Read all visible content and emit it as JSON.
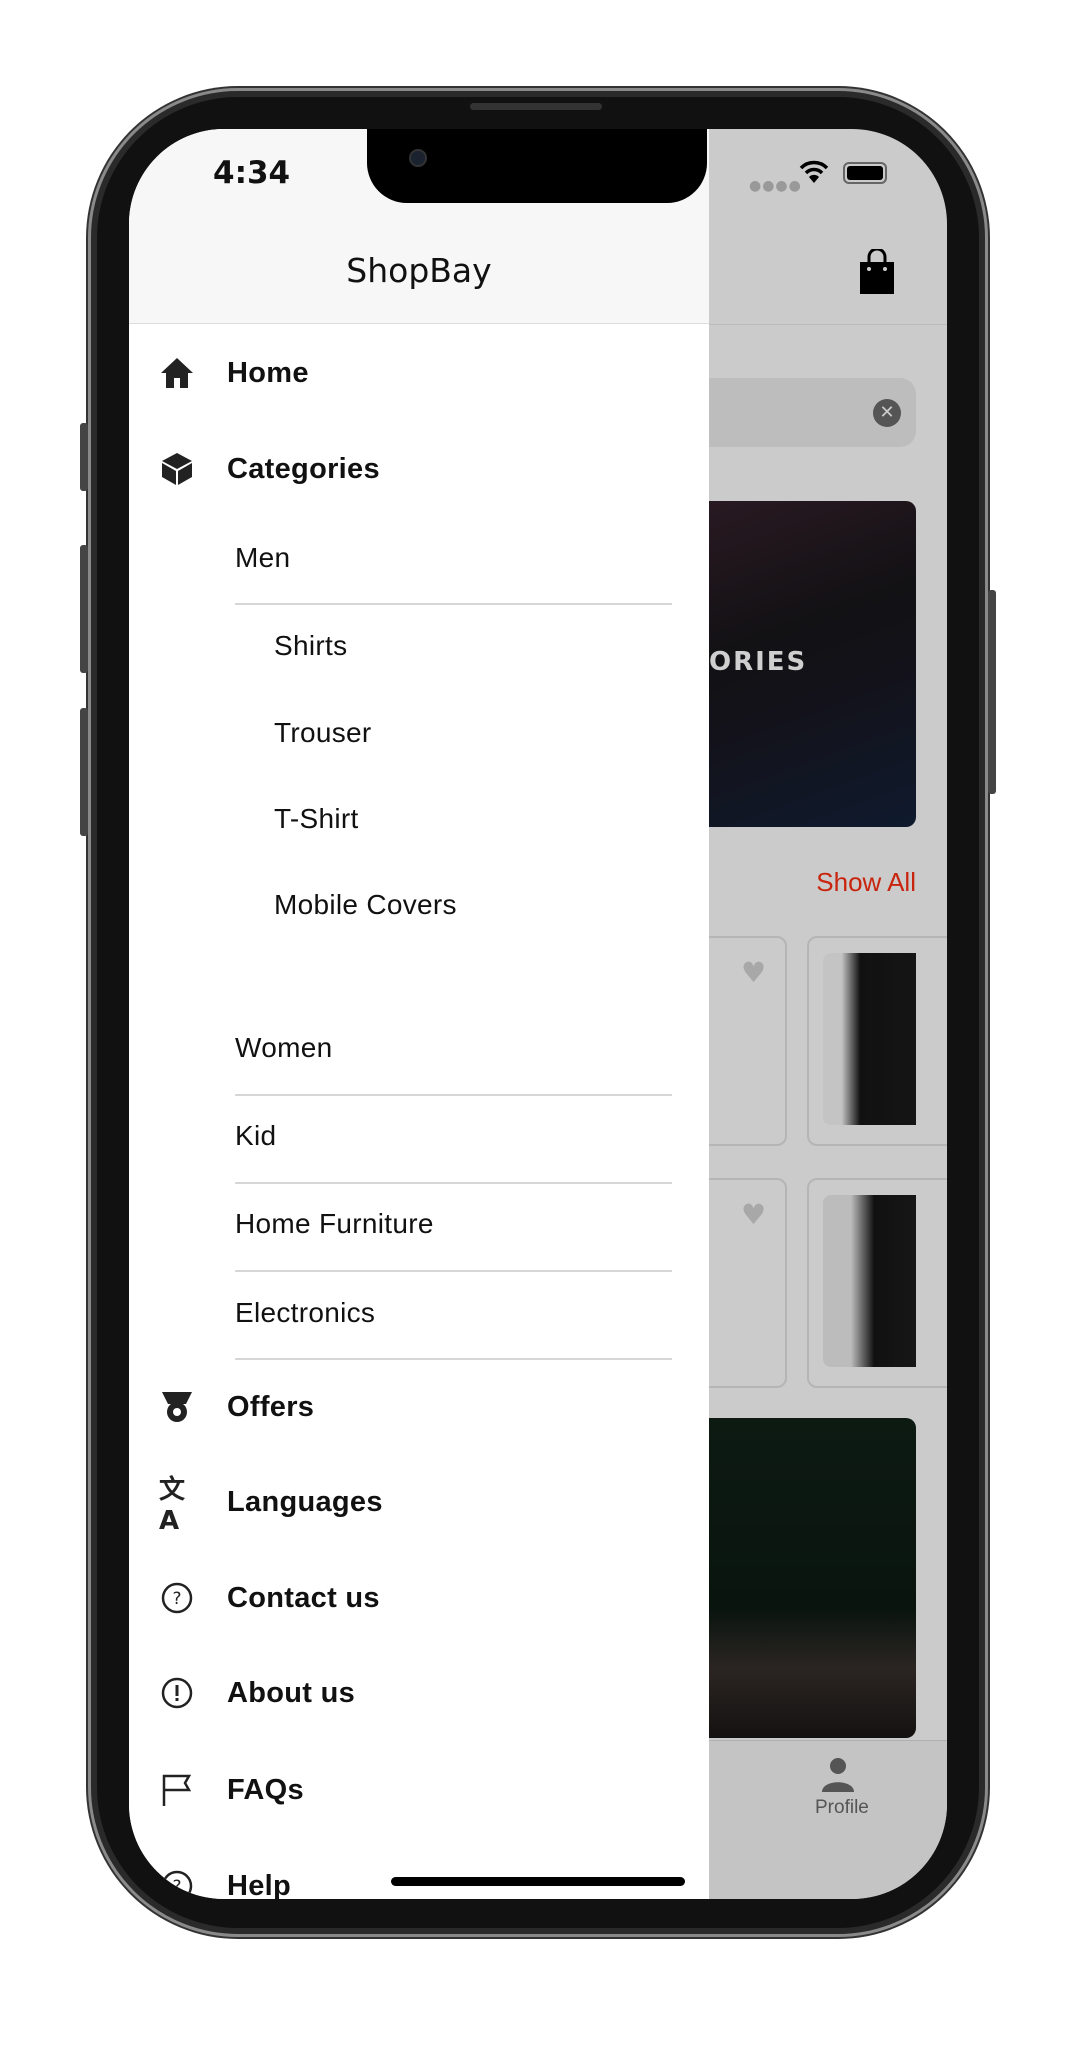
{
  "status": {
    "time": "4:34"
  },
  "drawer": {
    "title": "ShopBay",
    "items": [
      {
        "label": "Home",
        "icon": "home-icon"
      },
      {
        "label": "Categories",
        "icon": "cube-icon"
      }
    ],
    "categories": [
      {
        "label": "Men",
        "children": [
          "Shirts",
          "Trouser",
          "T-Shirt",
          "Mobile Covers"
        ]
      },
      {
        "label": "Women"
      },
      {
        "label": "Kid"
      },
      {
        "label": "Home Furniture"
      },
      {
        "label": "Electronics"
      }
    ],
    "bottom_items": [
      {
        "label": "Offers",
        "icon": "offer-badge-icon"
      },
      {
        "label": "Languages",
        "icon": "translate-icon"
      },
      {
        "label": "Contact us",
        "icon": "help-circle-icon"
      },
      {
        "label": "About us",
        "icon": "info-circle-icon"
      },
      {
        "label": "FAQs",
        "icon": "flag-icon"
      },
      {
        "label": "Help",
        "icon": "help-icon"
      }
    ]
  },
  "background": {
    "banner_text": "ORIES",
    "show_all": "Show All",
    "nav_profile": "Profile",
    "accent": "#c8240e"
  }
}
